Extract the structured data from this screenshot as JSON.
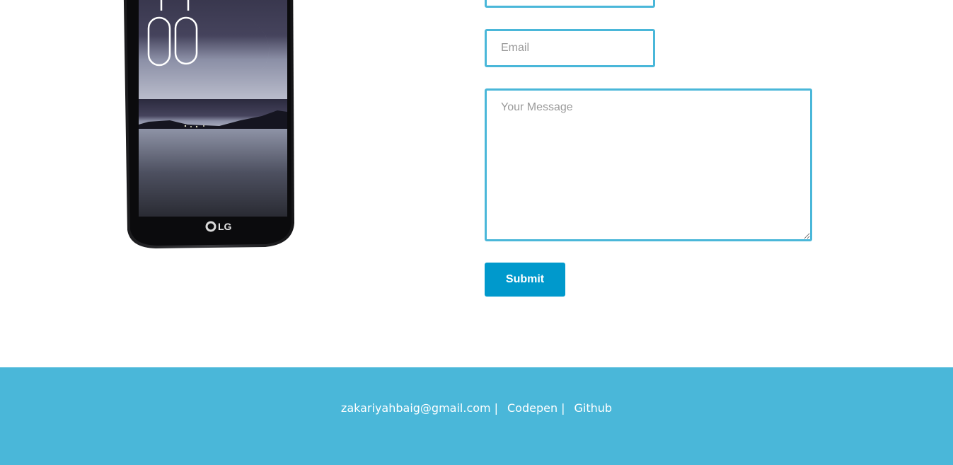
{
  "phone": {
    "brand": "LG",
    "image_name": "lg-smartphone-night-lake-image"
  },
  "form": {
    "email_placeholder": "Email",
    "message_placeholder": "Your Message",
    "submit_label": "Submit"
  },
  "footer": {
    "email_link": "zakariyahbaig@gmail.com",
    "codepen_link": "Codepen",
    "github_link": "Github",
    "separator": "|"
  },
  "colors": {
    "accent_border": "#4ab7d9",
    "button_bg": "#0099cc",
    "footer_bg": "#4ab7d9",
    "footer_text": "#ffffff"
  }
}
